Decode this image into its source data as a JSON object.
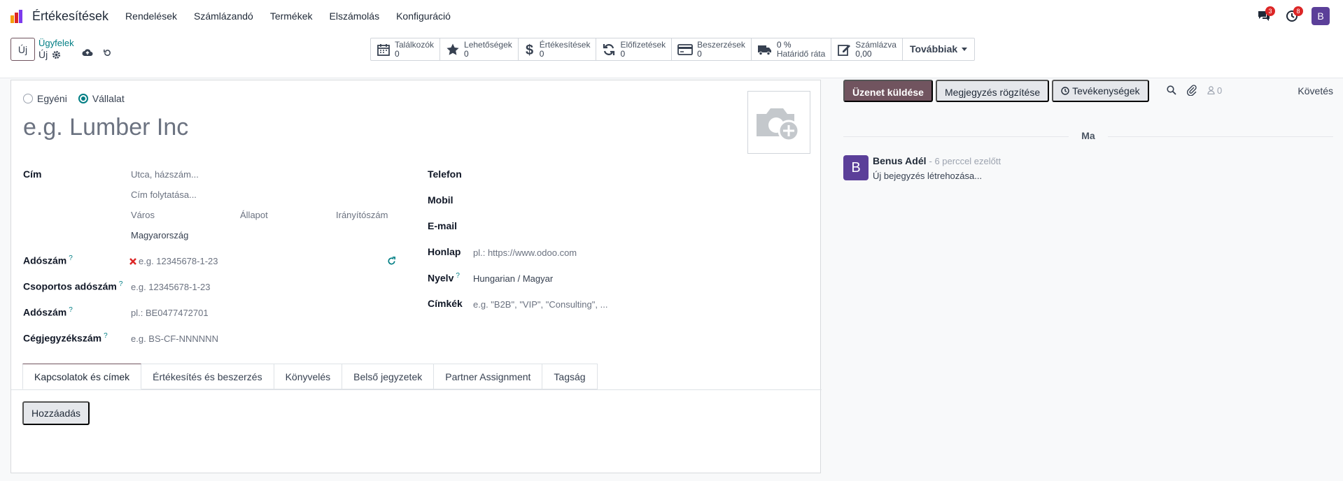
{
  "app": {
    "name": "Értékesítések"
  },
  "menu": [
    "Rendelések",
    "Számlázandó",
    "Termékek",
    "Elszámolás",
    "Konfiguráció"
  ],
  "systray": {
    "messages_count": "3",
    "activities_count": "8",
    "avatar_letter": "B"
  },
  "control": {
    "new_label": "Új",
    "breadcrumb_parent": "Ügyfelek",
    "breadcrumb_current": "Új",
    "smart_buttons": [
      {
        "label": "Találkozók",
        "value": "0",
        "icon": "calendar-icon"
      },
      {
        "label": "Lehetőségek",
        "value": "0",
        "icon": "star-icon"
      },
      {
        "label": "Értékesítések",
        "value": "0",
        "icon": "dollar-icon"
      },
      {
        "label": "Előfizetések",
        "value": "0",
        "icon": "refresh-icon"
      },
      {
        "label": "Beszerzések",
        "value": "0",
        "icon": "credit-card-icon"
      },
      {
        "label": "Határidő ráta",
        "value": "0 %",
        "icon": "truck-icon"
      },
      {
        "label": "Számlázva",
        "value": "0,00",
        "icon": "edit-icon"
      }
    ],
    "more_label": "Továbbiak"
  },
  "form": {
    "type_individual": "Egyéni",
    "type_company": "Vállalat",
    "name_placeholder": "e.g. Lumber Inc",
    "address_label": "Cím",
    "street_ph": "Utca, házszám...",
    "street2_ph": "Cím folytatása...",
    "city_ph": "Város",
    "state_ph": "Állapot",
    "zip_ph": "Irányítószám",
    "country": "Magyarország",
    "vat_label": "Adószám",
    "vat_ph": "e.g. 12345678-1-23",
    "group_vat_label": "Csoportos adószám",
    "group_vat_ph": "e.g. 12345678-1-23",
    "vat2_label": "Adószám",
    "vat2_ph": "pl.: BE0477472701",
    "company_reg_label": "Cégjegyzékszám",
    "company_reg_ph": "e.g. BS-CF-NNNNNN",
    "phone_label": "Telefon",
    "mobile_label": "Mobil",
    "email_label": "E-mail",
    "website_label": "Honlap",
    "website_ph": "pl.: https://www.odoo.com",
    "lang_label": "Nyelv",
    "lang_value": "Hungarian / Magyar",
    "tags_label": "Címkék",
    "tags_ph": "e.g. \"B2B\", \"VIP\", \"Consulting\", ...",
    "help_mark": "?"
  },
  "tabs": [
    "Kapcsolatok és címek",
    "Értékesítés és beszerzés",
    "Könyvelés",
    "Belső jegyzetek",
    "Partner Assignment",
    "Tagság"
  ],
  "add_label": "Hozzáadás",
  "chatter": {
    "send_message": "Üzenet küldése",
    "log_note": "Megjegyzés rögzítése",
    "activities": "Tevékenységek",
    "followers_count": "0",
    "follow": "Követés",
    "day": "Ma",
    "author": "Benus Adél",
    "time": "- 6 perccel ezelőtt",
    "body": "Új bejegyzés létrehozása...",
    "avatar_letter": "B"
  },
  "colors": {
    "brand": "#71545f",
    "accent": "#017e84",
    "avatar": "#5b3f99",
    "badge": "#dc2626"
  }
}
